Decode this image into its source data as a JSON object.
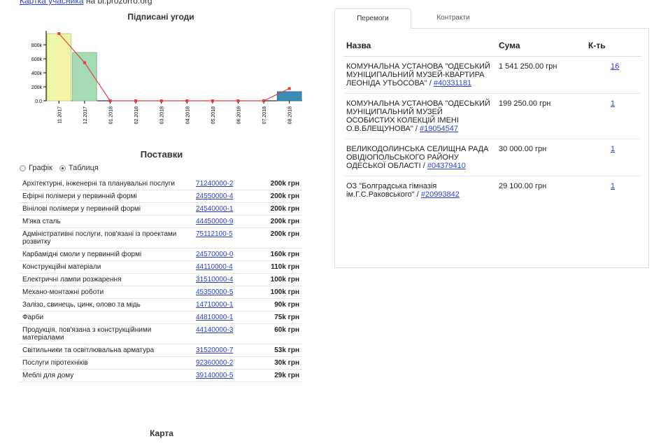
{
  "header": {
    "link_text": "Картка учасника",
    "suffix_text": " на bi.prozorro.org"
  },
  "chart_data": {
    "type": "bar",
    "title": "Підписані угоди",
    "categories": [
      "11.2017",
      "12.2017",
      "01.2018",
      "02.2018",
      "03.2018",
      "04.2018",
      "05.2018",
      "06.2018",
      "07.2018",
      "08.2018"
    ],
    "series": [
      {
        "values": [
          960000,
          690000,
          0,
          0,
          0,
          0,
          0,
          0,
          0,
          130000
        ],
        "kind": "bar"
      },
      {
        "values": [
          960000,
          545000,
          0,
          0,
          0,
          0,
          0,
          0,
          0,
          175000
        ],
        "kind": "line"
      }
    ],
    "bar_colors": [
      "#f1f5a8",
      "#a6dcb5",
      "#cccccc",
      "#cccccc",
      "#cccccc",
      "#cccccc",
      "#cccccc",
      "#cccccc",
      "#cccccc",
      "#3a8cb8"
    ],
    "bar_strokes": [
      "#c9cf7a",
      "#7fbf92",
      "#aaaaaa",
      "#aaaaaa",
      "#aaaaaa",
      "#aaaaaa",
      "#aaaaaa",
      "#aaaaaa",
      "#aaaaaa",
      "#2a6f96"
    ],
    "line_color": "#e53c3c",
    "yticks": [
      "0.0",
      "200k",
      "400k",
      "600k",
      "800k"
    ],
    "ylim": [
      0,
      1000000
    ],
    "xlabel": "",
    "ylabel": ""
  },
  "supplies": {
    "title": "Поставки",
    "view_options": [
      "Графік",
      "Таблиця"
    ],
    "selected_view": "Таблиця",
    "rows": [
      {
        "name": "Архітектурні, інженерні та планувальні послуги",
        "code": "71240000-2",
        "value": "200k грн"
      },
      {
        "name": "Ефірні полімери у первинній формі",
        "code": "24550000-4",
        "value": "200k грн"
      },
      {
        "name": "Вінілові полімери у первинній формі",
        "code": "24540000-1",
        "value": "200k грн"
      },
      {
        "name": "М'яка сталь",
        "code": "44450000-9",
        "value": "200k грн"
      },
      {
        "name": "Адміністративні послуги, пов'язані із проектами розвитку",
        "code": "75112100-5",
        "value": "200k грн"
      },
      {
        "name": "Карбамідні смоли у первинній формі",
        "code": "24570000-0",
        "value": "160k грн"
      },
      {
        "name": "Конструкційні матеріали",
        "code": "44110000-4",
        "value": "110k грн"
      },
      {
        "name": "Електричні лампи розжарення",
        "code": "31510000-4",
        "value": "100k грн"
      },
      {
        "name": "Механо-монтажні роботи",
        "code": "45350000-5",
        "value": "100k грн"
      },
      {
        "name": "Залізо, свинець, цинк, олово та мідь",
        "code": "14710000-1",
        "value": "90k грн"
      },
      {
        "name": "Фарби",
        "code": "44810000-1",
        "value": "75k грн"
      },
      {
        "name": "Продукція, пов'язана з конструкційними матеріалами",
        "code": "44140000-3",
        "value": "60k грн"
      },
      {
        "name": "Світильники та освітлювальна арматура",
        "code": "31520000-7",
        "value": "53k грн"
      },
      {
        "name": "Послуги піротехніків",
        "code": "92360000-2",
        "value": "30k грн"
      },
      {
        "name": "Меблі для дому",
        "code": "39140000-5",
        "value": "29k грн"
      }
    ]
  },
  "map": {
    "title": "Карта"
  },
  "tabs": {
    "items": [
      "Перемоги",
      "Контракти"
    ],
    "active": "Перемоги",
    "columns": [
      "Назва",
      "Сума",
      "К-ть"
    ],
    "rows": [
      {
        "name": "КОМУНАЛЬНА УСТАНОВА \"ОДЕСЬКИЙ МУНІЦИПАЛЬНИЙ МУЗЕЙ-КВАРТИРА ЛЕОНІДА УТЬОСОВА\" / ",
        "id": "#40331181",
        "sum": "1 541 250.00 грн",
        "count": "16"
      },
      {
        "name": "КОМУНАЛЬНА УСТАНОВА \"ОДЕСЬКИЙ МУНІЦИПАЛЬНИЙ МУЗЕЙ ОСОБИСТИХ КОЛЕКЦІЙ ІМЕНІ О.В.БЛЕЩУНОВА\" / ",
        "id": "#19054547",
        "sum": "199 250.00 грн",
        "count": "1"
      },
      {
        "name": "ВЕЛИКОДОЛИНСЬКА СЕЛИЩНА РАДА ОВІДІОПОЛЬСЬКОГО РАЙОНУ ОДЕСЬКОЇ ОБЛАСТІ / ",
        "id": "#04379410",
        "sum": "30 000.00 грн",
        "count": "1"
      },
      {
        "name": "ОЗ \"Болградська гімназія ім.Г.С.Раковського\" / ",
        "id": "#20993842",
        "sum": "29 100.00 грн",
        "count": "1"
      }
    ]
  }
}
